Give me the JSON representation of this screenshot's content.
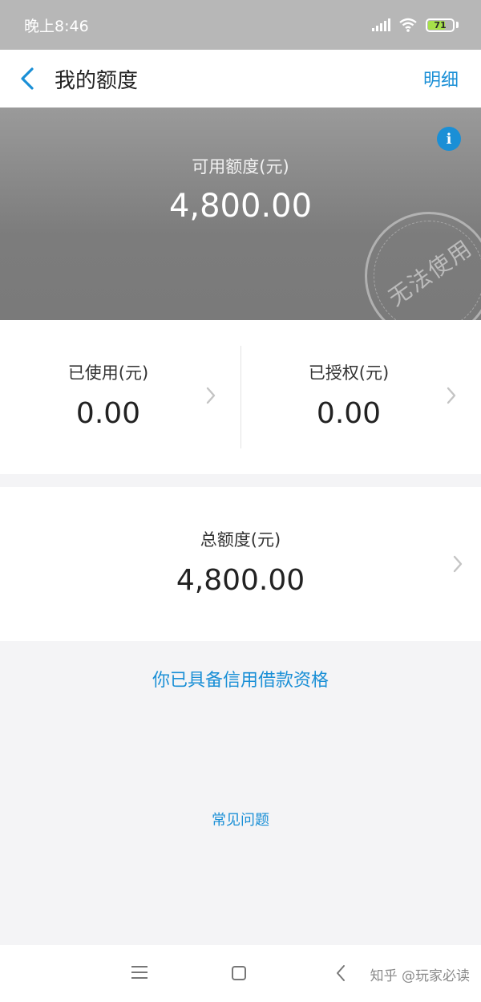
{
  "status_bar": {
    "time": "晚上8:46",
    "battery": "71",
    "icons": [
      "signal-icon",
      "wifi-icon",
      "battery-icon"
    ]
  },
  "nav": {
    "title": "我的额度",
    "detail_label": "明细",
    "back_icon": "chevron-left-icon"
  },
  "hero": {
    "label": "可用额度(元)",
    "value": "4,800.00",
    "stamp_text": "无法使用",
    "info_icon": "i"
  },
  "stats": {
    "used": {
      "label": "已使用(元)",
      "value": "0.00"
    },
    "authorized": {
      "label": "已授权(元)",
      "value": "0.00"
    }
  },
  "total": {
    "label": "总额度(元)",
    "value": "4,800.00"
  },
  "eligibility_text": "你已具备信用借款资格",
  "faq_label": "常见问题",
  "watermark": "知乎 @玩家必读",
  "colors": {
    "accent": "#1a8fd6",
    "hero_bg": "#808080",
    "status_bar_bg": "#b7b7b7",
    "page_bg": "#f4f4f6"
  }
}
